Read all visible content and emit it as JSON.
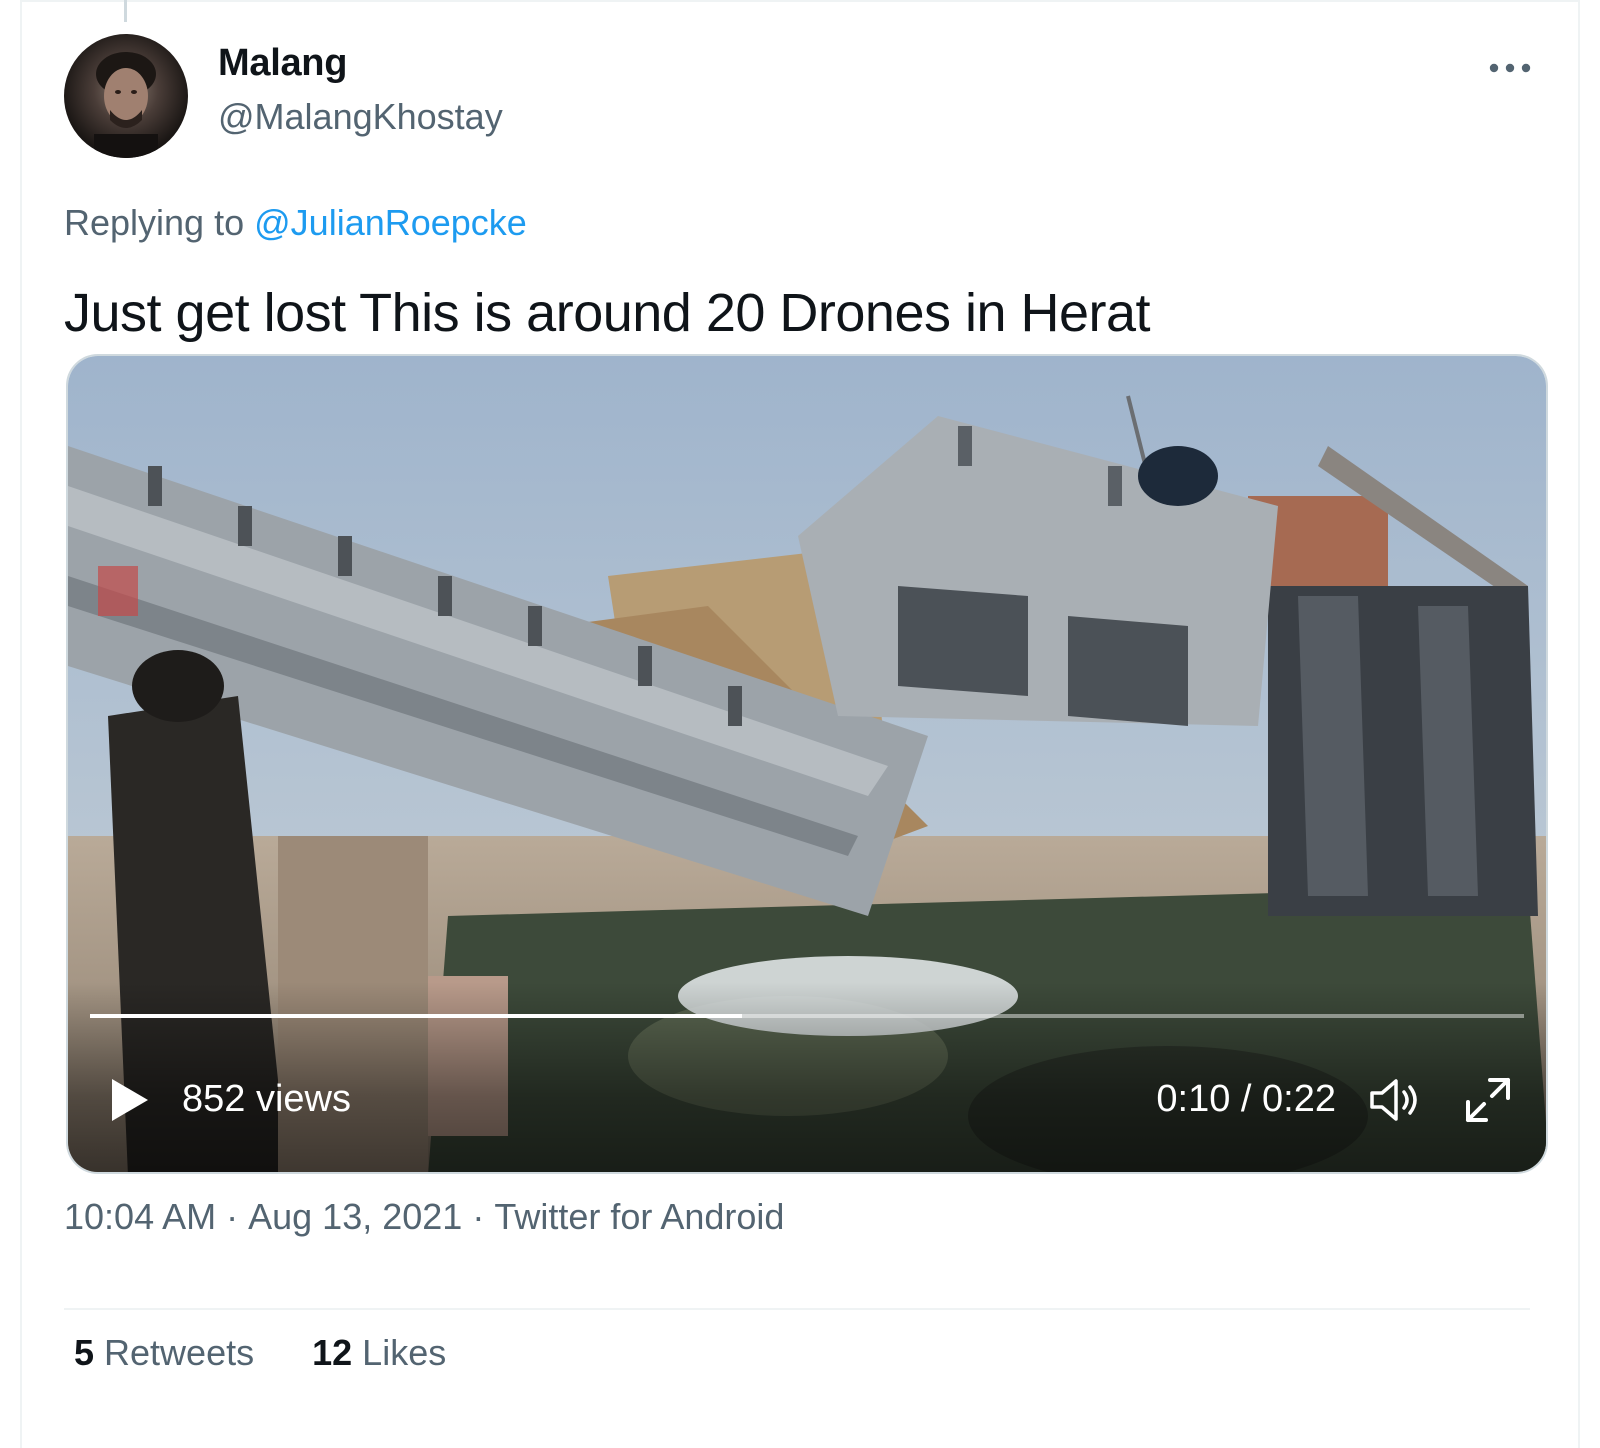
{
  "user": {
    "display_name": "Malang",
    "handle": "@MalangKhostay"
  },
  "reply": {
    "prefix": "Replying to",
    "to_handle": "@JulianRoepcke"
  },
  "tweet": {
    "text": "Just get lost This is around 20 Drones in Herat"
  },
  "video": {
    "views": "852 views",
    "time": "0:10 / 0:22",
    "progress_fraction": 0.4545
  },
  "meta": {
    "time": "10:04 AM",
    "date": "Aug 13, 2021",
    "source": "Twitter for Android",
    "separator": "·"
  },
  "stats": {
    "retweets_count": "5",
    "retweets_label": "Retweets",
    "likes_count": "12",
    "likes_label": "Likes"
  },
  "icons": {
    "more": "more-horizontal-icon",
    "play": "play-icon",
    "volume": "volume-icon",
    "fullscreen": "fullscreen-icon"
  },
  "colors": {
    "link": "#1d9bf0",
    "text_primary": "#0f1419",
    "text_secondary": "#536471"
  }
}
